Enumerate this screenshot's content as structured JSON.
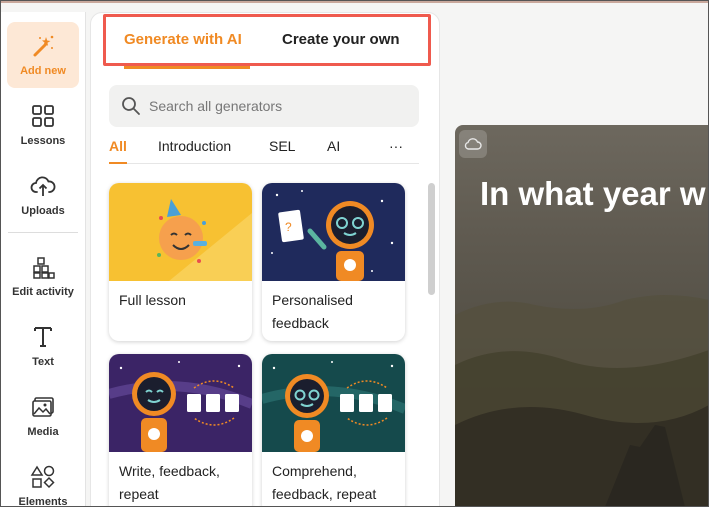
{
  "sidebar": {
    "items": [
      {
        "label": "Add new",
        "icon": "magic-wand-icon"
      },
      {
        "label": "Lessons",
        "icon": "grid-icon"
      },
      {
        "label": "Uploads",
        "icon": "cloud-upload-icon"
      },
      {
        "label": "Edit activity",
        "icon": "blocks-icon"
      },
      {
        "label": "Text",
        "icon": "text-icon"
      },
      {
        "label": "Media",
        "icon": "image-icon"
      },
      {
        "label": "Elements",
        "icon": "shapes-icon"
      }
    ]
  },
  "panel": {
    "tabs": [
      {
        "label": "Generate with AI"
      },
      {
        "label": "Create your own"
      }
    ],
    "search": {
      "placeholder": "Search all generators"
    },
    "filters": [
      {
        "label": "All"
      },
      {
        "label": "Introduction"
      },
      {
        "label": "SEL"
      },
      {
        "label": "AI"
      },
      {
        "label": "···"
      }
    ],
    "cards": [
      {
        "label": "Full lesson"
      },
      {
        "label": "Personalised feedback"
      },
      {
        "label": "Write, feedback, repeat"
      },
      {
        "label": "Comprehend, feedback, repeat"
      }
    ]
  },
  "canvas": {
    "title": "In what year w"
  },
  "colors": {
    "accent": "#f08a24",
    "highlight": "#ef5a4e"
  }
}
